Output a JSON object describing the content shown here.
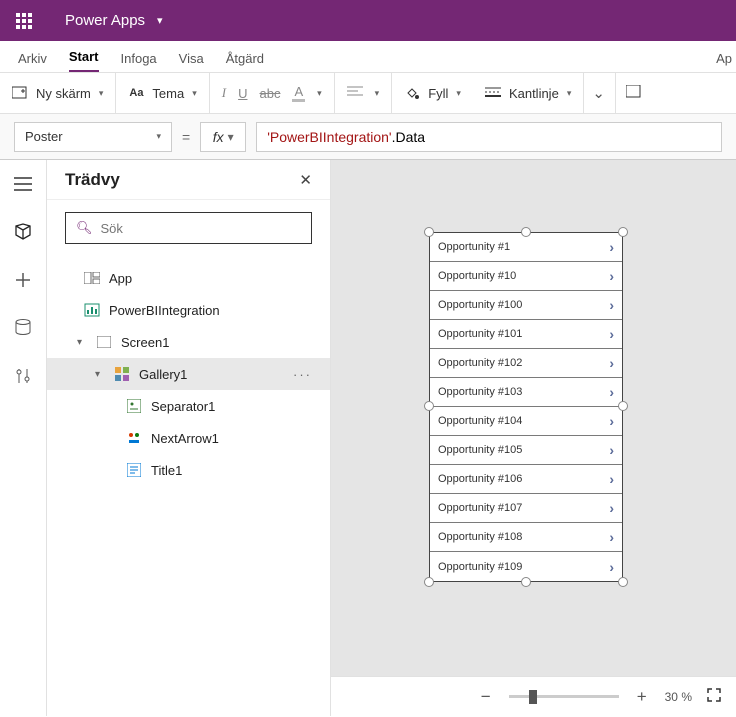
{
  "titlebar": {
    "app_name": "Power Apps"
  },
  "menubar": {
    "items": [
      "Arkiv",
      "Start",
      "Infoga",
      "Visa",
      "Åtgärd"
    ],
    "active": 1,
    "right": "Ap"
  },
  "toolbar": {
    "new_screen": "Ny skärm",
    "theme": "Tema",
    "fill": "Fyll",
    "border": "Kantlinje"
  },
  "formula": {
    "property": "Poster",
    "fx": "fx",
    "literal": "'PowerBIIntegration'",
    "member": ".Data"
  },
  "tree": {
    "title": "Trädvy",
    "search_placeholder": "Sök",
    "nodes": {
      "app": "App",
      "pbi": "PowerBIIntegration",
      "screen": "Screen1",
      "gallery": "Gallery1",
      "sep": "Separator1",
      "next": "NextArrow1",
      "title1": "Title1"
    }
  },
  "gallery_items": [
    "Opportunity #1",
    "Opportunity #10",
    "Opportunity #100",
    "Opportunity #101",
    "Opportunity #102",
    "Opportunity #103",
    "Opportunity #104",
    "Opportunity #105",
    "Opportunity #106",
    "Opportunity #107",
    "Opportunity #108",
    "Opportunity #109"
  ],
  "status": {
    "zoom": "30",
    "zoom_unit": "%"
  }
}
